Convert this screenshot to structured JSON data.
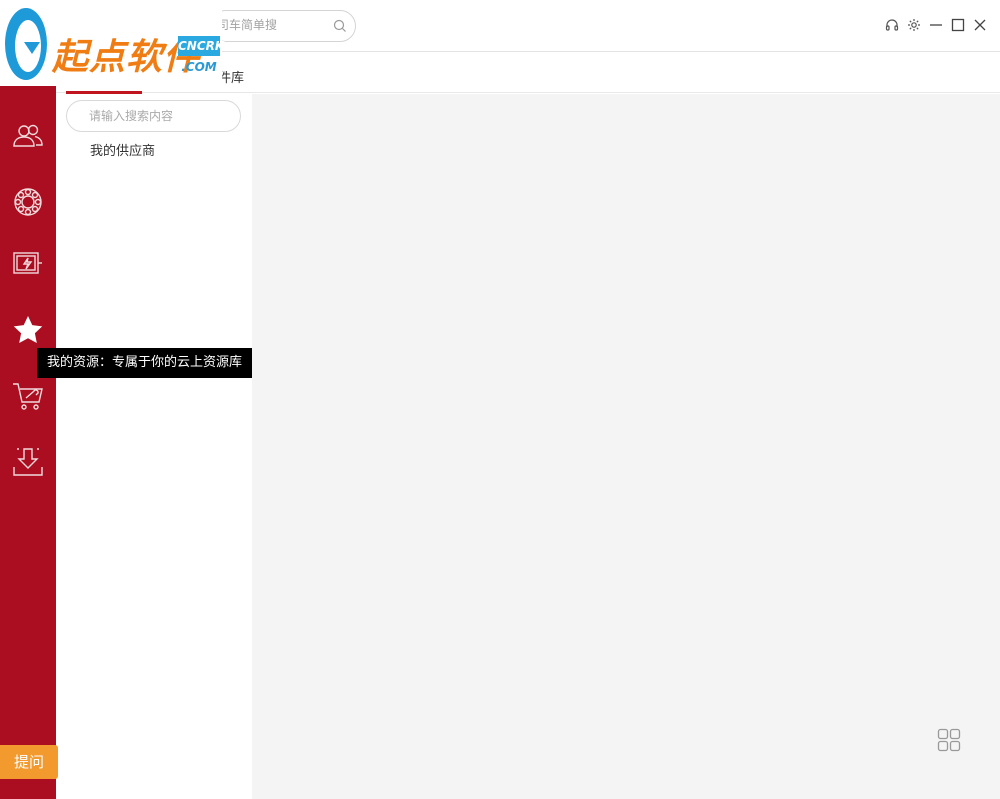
{
  "header": {
    "search_placeholder": "司车简单搜"
  },
  "tabs": [
    {
      "label": "件库",
      "active": true
    }
  ],
  "panel": {
    "search_placeholder": "请输入搜索内容",
    "items": [
      "我的供应商"
    ]
  },
  "rail": {
    "icons": [
      "user-group-icon",
      "gear-wheel-icon",
      "monitor-flash-icon",
      "star-icon",
      "cart-wrench-icon",
      "download-tray-icon"
    ],
    "tooltip": "我的资源：专属于你的云上资源库"
  },
  "ask_button": "提问",
  "logo": {
    "brand": "起点软件",
    "badge_top": "CNCRK",
    "badge_bottom": ".COM"
  },
  "colors": {
    "rail": "#ab0e20",
    "accent": "#c0141f",
    "ask": "#f39a2f",
    "content_bg": "#f4f4f4"
  }
}
